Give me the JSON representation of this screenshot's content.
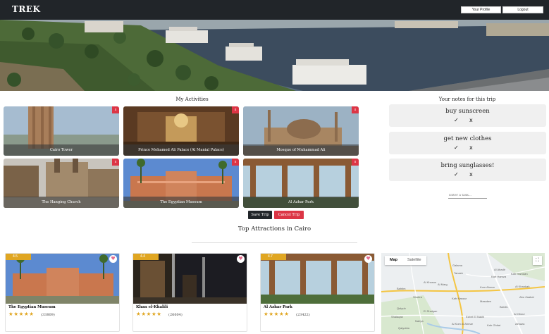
{
  "navbar": {
    "brand": "TREK",
    "profile_label": "Your Profile",
    "logout_label": "Logout",
    "background": "#212529"
  },
  "activities": {
    "title": "My Activities",
    "remove_label": "x",
    "items": [
      {
        "label": "Cairo Tower"
      },
      {
        "label": "Prince Mohamed Ali Palace (Al Manial Palace)"
      },
      {
        "label": "Mosque of Muhammad Ali"
      },
      {
        "label": "The Hanging Church"
      },
      {
        "label": "The Egyptian Museum"
      },
      {
        "label": "Al Azhar Park"
      }
    ],
    "save_label": "Save Trip",
    "cancel_label": "Cancel Trip"
  },
  "notes": {
    "title": "Your notes for this trip",
    "check_glyph": "✓",
    "delete_glyph": "x",
    "items": [
      {
        "text": "buy sunscreen"
      },
      {
        "text": "get new clothes"
      },
      {
        "text": "bring sunglasses!"
      }
    ],
    "input_placeholder": "Enter a task..."
  },
  "attractions": {
    "title": "Top Attractions in Cairo",
    "heart_icon": "heart-icon",
    "items": [
      {
        "name": "The Egyptian Museum",
        "rating_badge": "4.5",
        "rating": 4.5,
        "stars": "★★★★★",
        "count": "(33809)"
      },
      {
        "name": "Khan el-Khalili",
        "rating_badge": "4.4",
        "rating": 4.4,
        "stars": "★★★★★",
        "count": "(26604)"
      },
      {
        "name": "Al Azhar Park",
        "rating_badge": "4.7",
        "rating": 4.7,
        "stars": "★★★★★",
        "count": "(23422)"
      }
    ]
  },
  "map": {
    "tab_map": "Map",
    "tab_satellite": "Satellite",
    "fullscreen_icon": "⛶",
    "labels": [
      "Galama",
      "Tanash",
      "Al Abadir",
      "Kafr Hamza",
      "Al Khusus",
      "Kafr Hamdan",
      "Al Marg",
      "Kom Ahmar",
      "Al Khankah",
      "Bahtim",
      "Shubra",
      "Abu Zaabal",
      "Kafr Nassar",
      "Masaken",
      "Bardis",
      "Qalyub",
      "El Shalqan",
      "Al Obour",
      "Shalaqan",
      "Ezbet El Nakhl",
      "Nahya",
      "Al Kom Al Ahmar",
      "Kafr Ghitat",
      "Almaza",
      "Qalyubia"
    ]
  },
  "colors": {
    "danger": "#dc3545",
    "dark": "#212529",
    "gold": "#e0a622",
    "heart": "#e46c8d",
    "note_bg": "#f0f0f0"
  }
}
